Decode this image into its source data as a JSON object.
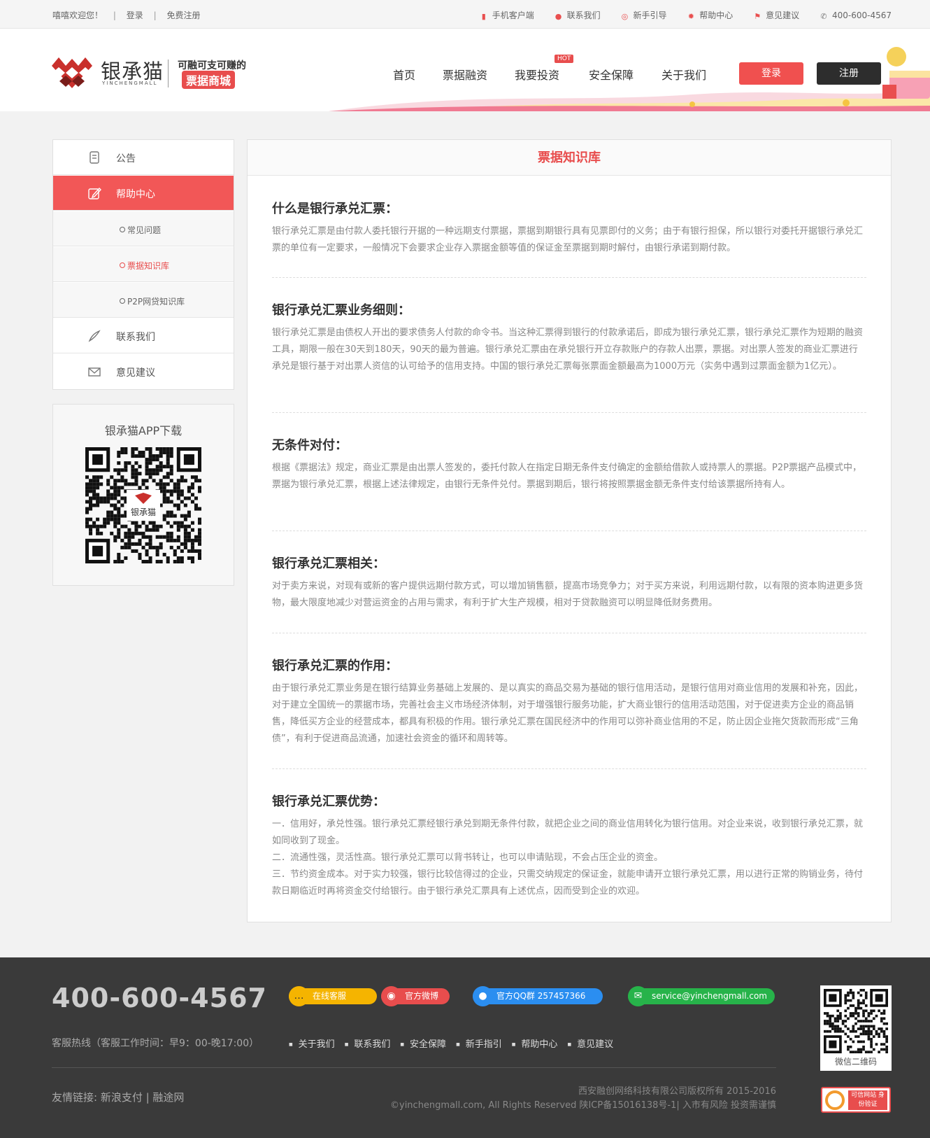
{
  "topbar": {
    "welcome": "嘻嘻欢迎您！",
    "login": "登录",
    "register": "免费注册",
    "links": [
      {
        "label": "手机客户端",
        "icon": "mobile-icon"
      },
      {
        "label": "联系我们",
        "icon": "location-icon"
      },
      {
        "label": "新手引导",
        "icon": "guide-icon"
      },
      {
        "label": "帮助中心",
        "icon": "gear-icon"
      },
      {
        "label": "意见建议",
        "icon": "flag-icon"
      },
      {
        "label": "400-600-4567",
        "icon": "phone-icon"
      }
    ]
  },
  "header": {
    "logo_name": "银承猫",
    "logo_sub": "YINCHENGMALL",
    "slogan": "可融可支可赚的",
    "slogan_badge": "票据商城",
    "nav": [
      "首页",
      "票据融资",
      "我要投资",
      "安全保障",
      "关于我们"
    ],
    "hot_badge": "HOT",
    "login_button": "登录",
    "register_button": "注册"
  },
  "sidebar": {
    "items": [
      {
        "label": "公告",
        "icon": "document-icon"
      },
      {
        "label": "帮助中心",
        "icon": "edit-icon"
      },
      {
        "label": "常见问题"
      },
      {
        "label": "票据知识库"
      },
      {
        "label": "P2P网贷知识库"
      },
      {
        "label": "联系我们",
        "icon": "pen-icon"
      },
      {
        "label": "意见建议",
        "icon": "mail-icon"
      }
    ],
    "app_title": "银承猫APP下载",
    "qr_logo": "银承猫"
  },
  "content": {
    "title": "票据知识库",
    "sections": [
      {
        "heading": "什么是银行承兑汇票：",
        "body": "银行承兑汇票是由付款人委托银行开据的一种远期支付票据，票据到期银行具有见票即付的义务；由于有银行担保，所以银行对委托开据银行承兑汇票的单位有一定要求，一般情况下会要求企业存入票据金额等值的保证金至票据到期时解付，由银行承诺到期付款。"
      },
      {
        "heading": "银行承兑汇票业务细则：",
        "body": "银行承兑汇票是由债权人开出的要求债务人付款的命令书。当这种汇票得到银行的付款承诺后，即成为银行承兑汇票，银行承兑汇票作为短期的融资工具，期限一般在30天到180天，90天的最为普遍。银行承兑汇票由在承兑银行开立存款账户的存款人出票，票据。对出票人签发的商业汇票进行承兑是银行基于对出票人资信的认可给予的信用支持。中国的银行承兑汇票每张票面金额最高为1000万元（实务中遇到过票面金额为1亿元）。"
      },
      {
        "heading": "无条件对付：",
        "body": "根据《票据法》规定，商业汇票是由出票人签发的，委托付款人在指定日期无条件支付确定的金额给借款人或持票人的票据。P2P票据产品模式中，票据为银行承兑汇票，根据上述法律规定，由银行无条件兑付。票据到期后，银行将按照票据金额无条件支付给该票据所持有人。"
      },
      {
        "heading": "银行承兑汇票相关：",
        "body": "对于卖方来说，对现有或新的客户提供远期付款方式，可以增加销售额，提高市场竞争力；对于买方来说，利用远期付款，以有限的资本购进更多货物，最大限度地减少对营运资金的占用与需求，有利于扩大生产规模，相对于贷款融资可以明显降低财务费用。"
      },
      {
        "heading": "银行承兑汇票的作用：",
        "body": "由于银行承兑汇票业务是在银行结算业务基础上发展的、是以真实的商品交易为基础的银行信用活动，是银行信用对商业信用的发展和补充，因此，对于建立全国统一的票据市场，完善社会主义市场经济体制，对于增强银行服务功能，扩大商业银行的信用活动范围，对于促进卖方企业的商品销售，降低买方企业的经营成本，都具有积极的作用。银行承兑汇票在国民经济中的作用可以弥补商业信用的不足，防止因企业拖欠货款而形成“三角债”，有利于促进商品流通，加速社会资金的循环和周转等。"
      },
      {
        "heading": "银行承兑汇票优势：",
        "lines": [
          "一．信用好，承兑性强。银行承兑汇票经银行承兑到期无条件付款，就把企业之间的商业信用转化为银行信用。对企业来说，收到银行承兑汇票，就如同收到了现金。",
          "二．流通性强，灵活性高。银行承兑汇票可以背书转让，也可以申请贴现，不会占压企业的资金。",
          "三．节约资金成本。对于实力较强，银行比较信得过的企业，只需交纳规定的保证金，就能申请开立银行承兑汇票，用以进行正常的购销业务，待付款日期临近时再将资金交付给银行。由于银行承兑汇票具有上述优点，因而受到企业的欢迎。"
        ]
      }
    ]
  },
  "footer": {
    "phone": "400-600-4567",
    "hotline": "客服热线（客服工作时间：早9：00-晚17:00）",
    "contacts": [
      {
        "label": "在线客服",
        "icon": "chat-icon",
        "color": "#f5b400"
      },
      {
        "label": "官方微博",
        "icon": "weibo-icon",
        "color": "#e84d4d"
      },
      {
        "label": "官方QQ群 257457366",
        "icon": "qq-icon",
        "color": "#2b8ef0"
      },
      {
        "label": "service@yinchengmall.com",
        "icon": "mail-icon",
        "color": "#27b34a"
      }
    ],
    "links": [
      "关于我们",
      "联系我们",
      "安全保障",
      "新手指引",
      "帮助中心",
      "意见建议"
    ],
    "friend_links": "友情链接: 新浪支付 | 融途网",
    "company": "西安融创网络科技有限公司版权所有 2015-2016",
    "copyright": "©yinchengmall.com, All Rights Reserved 陕ICP备15016138号-1| 入市有风险 投资需谨慎",
    "qr_caption": "微信二维码",
    "badge_text": "可信网站 身份验证"
  },
  "colors": {
    "accent": "#f25757",
    "dark": "#2d2d2d",
    "footer_bg": "#3a3a3a"
  }
}
